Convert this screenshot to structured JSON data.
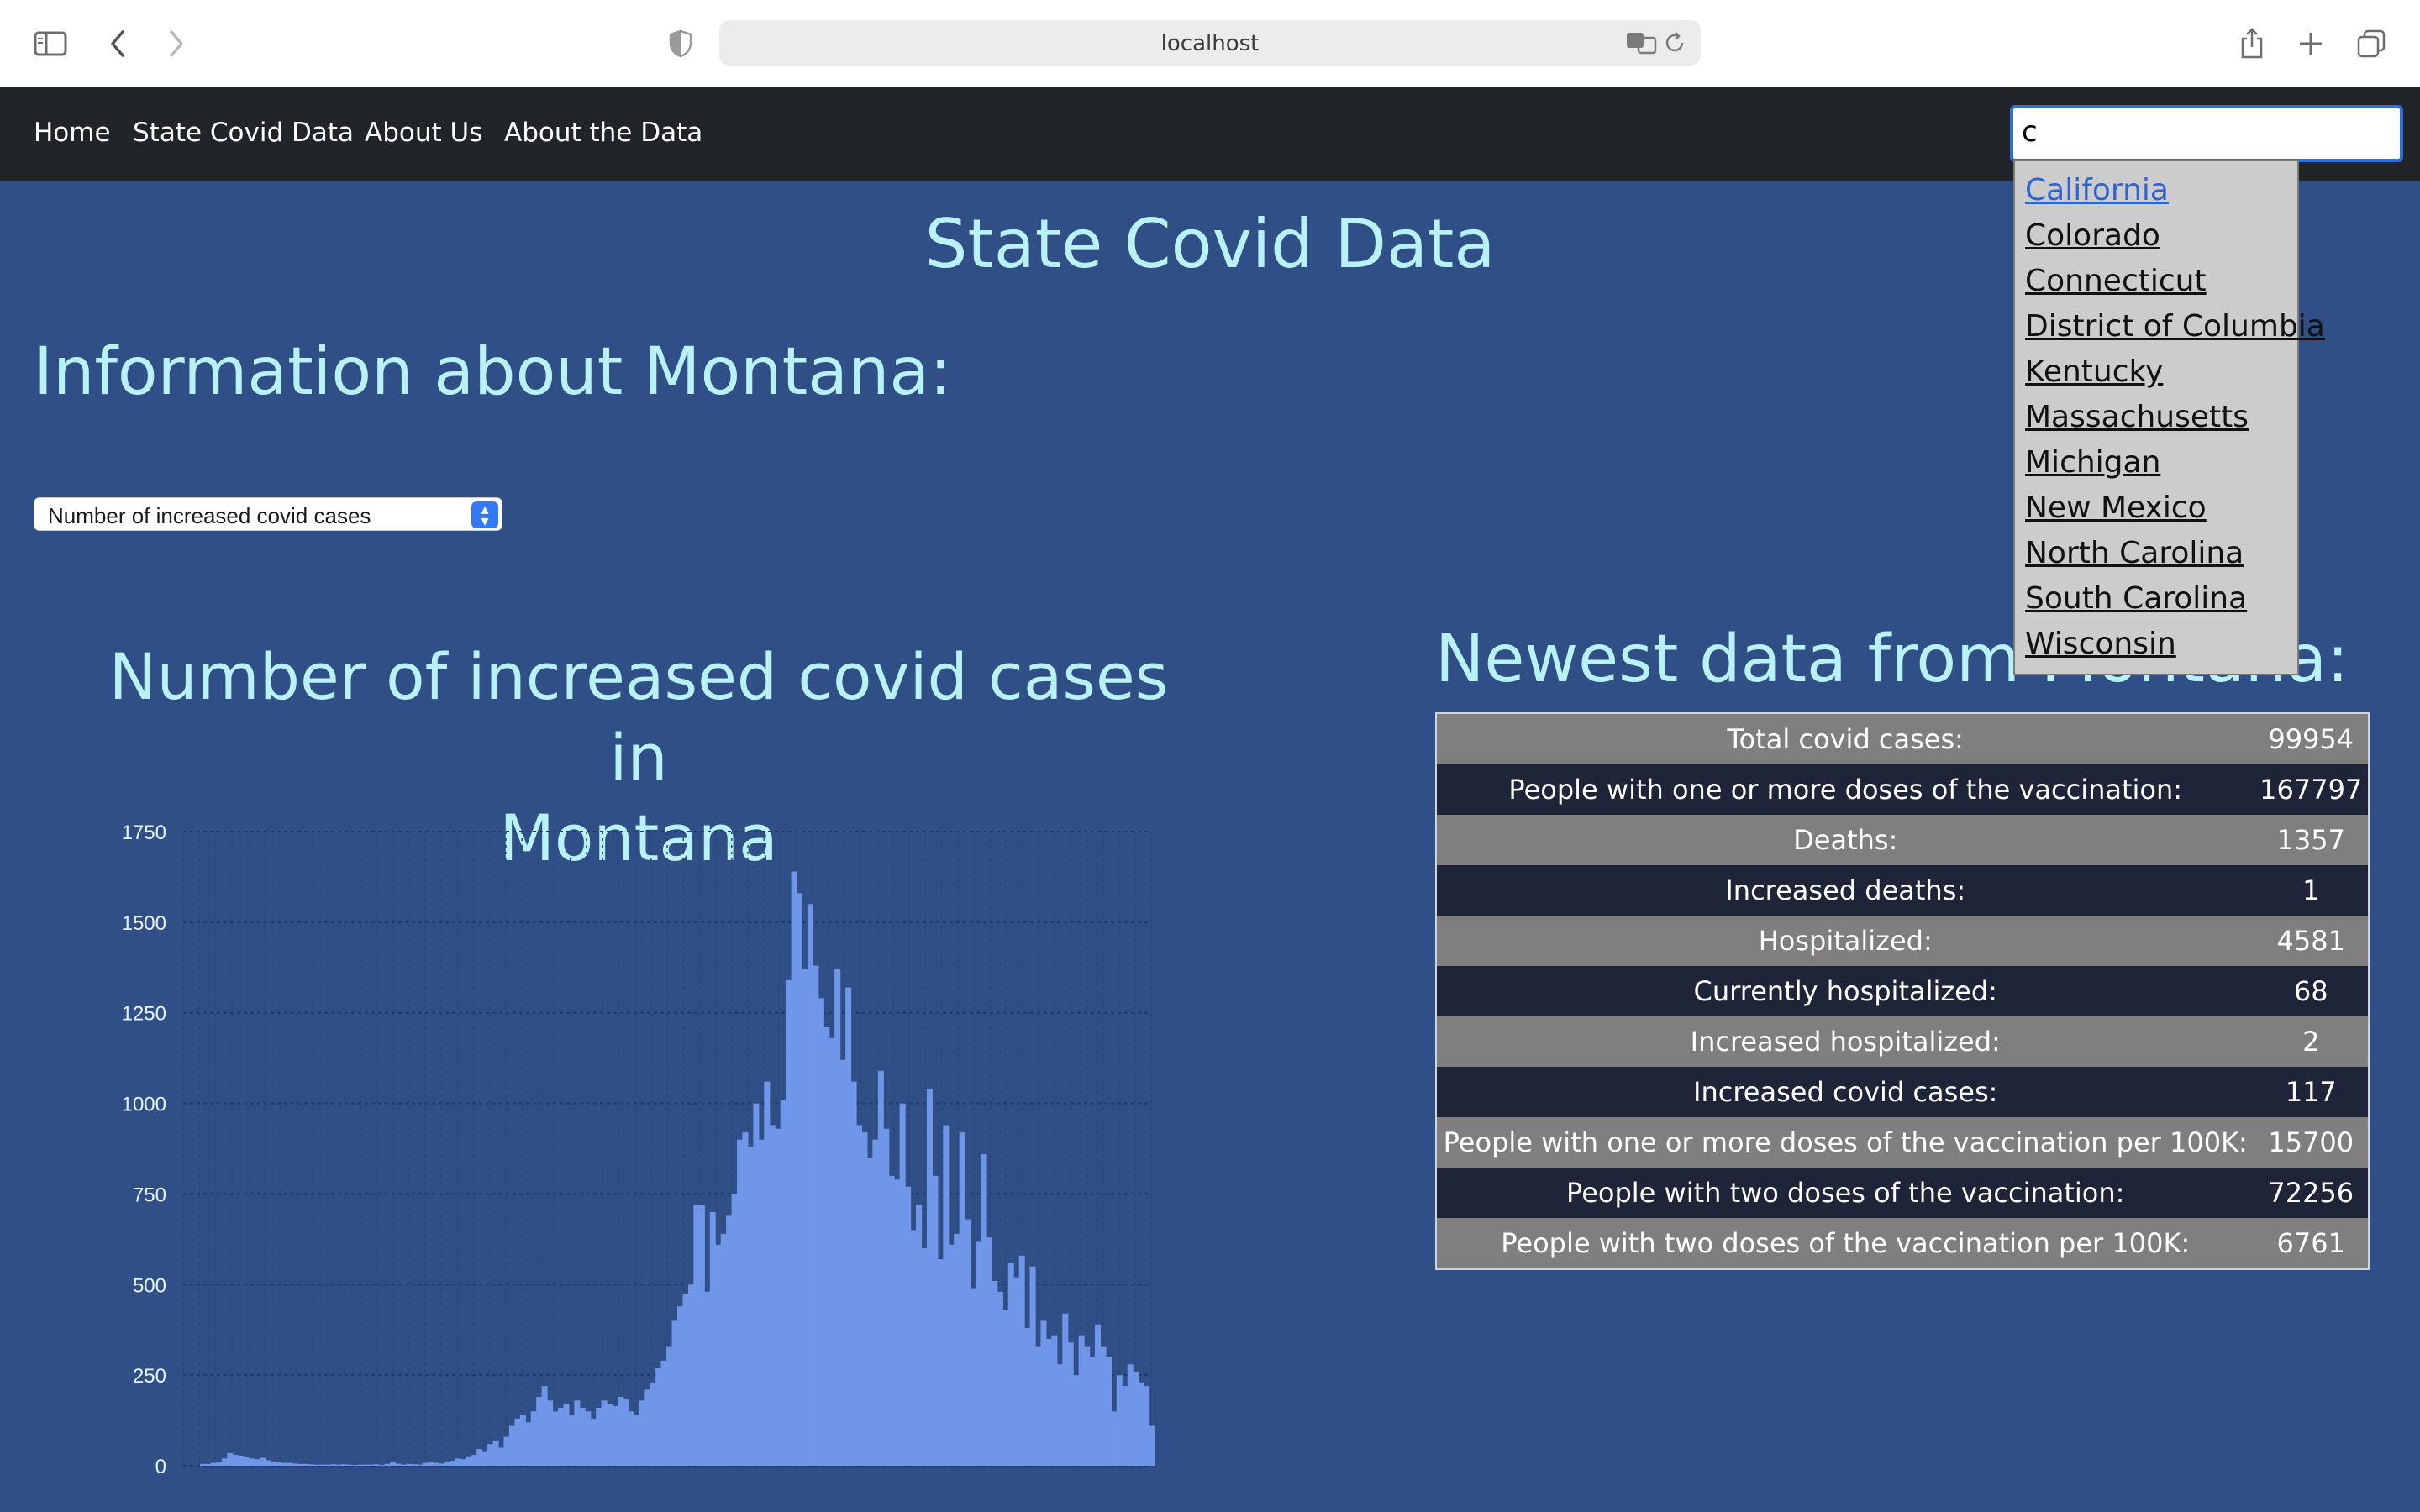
{
  "browser": {
    "url": "localhost"
  },
  "navbar": {
    "links": [
      "Home",
      "State Covid Data",
      "About Us",
      "About the Data"
    ],
    "search_value": "c"
  },
  "page": {
    "title": "State Covid Data",
    "info_heading": "Information about Montana:",
    "metric_select": "Number of increased covid cases",
    "chart_heading_line1": "Number of increased covid cases in",
    "chart_heading_line2": "Montana",
    "newest_heading": "Newest data from Montana:"
  },
  "autocomplete": {
    "options": [
      "California",
      "Colorado",
      "Connecticut",
      "District of Columbia",
      "Kentucky",
      "Massachusetts",
      "Michigan",
      "New Mexico",
      "North Carolina",
      "South Carolina",
      "Wisconsin"
    ],
    "active_index": 0
  },
  "stats": [
    {
      "label": "Total covid cases:",
      "value": "99954"
    },
    {
      "label": "People with one or more doses of the vaccination:",
      "value": "167797"
    },
    {
      "label": "Deaths:",
      "value": "1357"
    },
    {
      "label": "Increased deaths:",
      "value": "1"
    },
    {
      "label": "Hospitalized:",
      "value": "4581"
    },
    {
      "label": "Currently hospitalized:",
      "value": "68"
    },
    {
      "label": "Increased hospitalized:",
      "value": "2"
    },
    {
      "label": "Increased covid cases:",
      "value": "117"
    },
    {
      "label": "People with one or more doses of the vaccination per 100K:",
      "value": "15700"
    },
    {
      "label": "People with two doses of the vaccination:",
      "value": "72256"
    },
    {
      "label": "People with two doses of the vaccination per 100K:",
      "value": "6761"
    }
  ],
  "colors": {
    "page_bg": "#2f4f86",
    "navbar_bg": "#212429",
    "heading": "#b9f2f6",
    "bar": "#6f96e8",
    "row_light": "#7f7f7f",
    "row_dark": "#1e2538",
    "link_active": "#2e63d4"
  },
  "chart_data": {
    "type": "bar",
    "title": "",
    "xlabel": "",
    "ylabel": "",
    "ylim": [
      0,
      1750
    ],
    "yticks": [
      0,
      250,
      500,
      750,
      1000,
      1250,
      1500,
      1750
    ],
    "grid": true,
    "values": [
      5,
      5,
      8,
      10,
      20,
      35,
      30,
      28,
      25,
      20,
      18,
      22,
      15,
      12,
      10,
      8,
      8,
      6,
      5,
      5,
      4,
      3,
      3,
      3,
      4,
      3,
      4,
      3,
      2,
      3,
      3,
      3,
      4,
      2,
      5,
      10,
      6,
      3,
      5,
      4,
      3,
      8,
      10,
      8,
      6,
      12,
      14,
      20,
      18,
      26,
      30,
      46,
      40,
      60,
      70,
      50,
      80,
      110,
      130,
      140,
      120,
      150,
      190,
      220,
      180,
      150,
      160,
      170,
      140,
      180,
      160,
      150,
      130,
      160,
      180,
      170,
      165,
      190,
      185,
      150,
      140,
      180,
      210,
      230,
      270,
      290,
      330,
      400,
      440,
      475,
      500,
      720,
      720,
      480,
      700,
      610,
      640,
      690,
      750,
      900,
      920,
      880,
      1000,
      900,
      1060,
      940,
      930,
      1010,
      1340,
      1640,
      1580,
      1370,
      1550,
      1380,
      1290,
      1210,
      1180,
      1370,
      1120,
      1320,
      1060,
      940,
      920,
      850,
      900,
      1090,
      930,
      800,
      790,
      1000,
      770,
      650,
      720,
      600,
      1040,
      800,
      570,
      940,
      610,
      640,
      920,
      680,
      490,
      620,
      860,
      630,
      510,
      480,
      430,
      560,
      520,
      580,
      380,
      550,
      330,
      400,
      350,
      360,
      280,
      420,
      340,
      250,
      360,
      330,
      300,
      390,
      330,
      300,
      150,
      250,
      220,
      280,
      260,
      230,
      220,
      110
    ],
    "x_first": 129,
    "x_last": 747,
    "x_axis_left": 118,
    "x_axis_right": 744
  }
}
